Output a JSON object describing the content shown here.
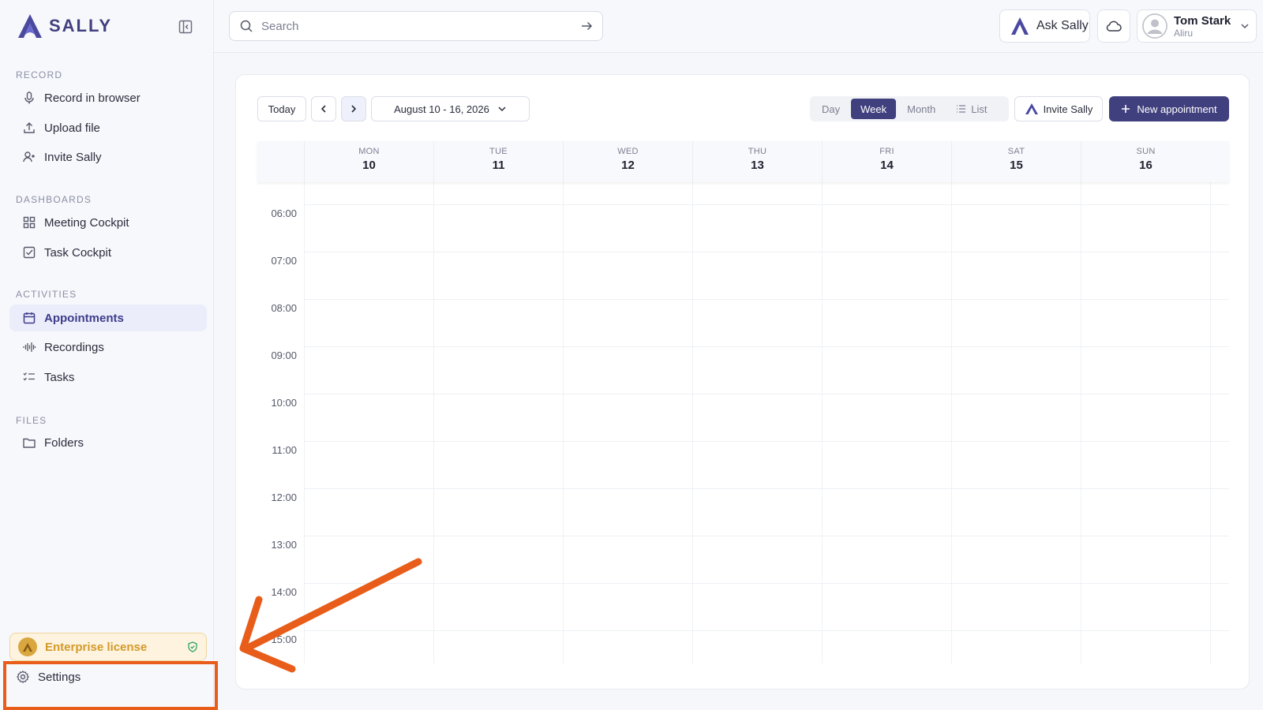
{
  "app": {
    "logo_text": "SALLY"
  },
  "sidebar": {
    "sections": {
      "record": "RECORD",
      "dashboards": "DASHBOARDS",
      "activities": "ACTIVITIES",
      "files": "FILES"
    },
    "items": {
      "record_in_browser": "Record in browser",
      "upload_file": "Upload file",
      "invite_sally": "Invite Sally",
      "meeting_cockpit": "Meeting Cockpit",
      "task_cockpit": "Task Cockpit",
      "appointments": "Appointments",
      "recordings": "Recordings",
      "tasks": "Tasks",
      "folders": "Folders"
    },
    "active_item": "appointments",
    "license": "Enterprise license",
    "settings": "Settings"
  },
  "topbar": {
    "search_placeholder": "Search",
    "ask_label": "Ask Sally",
    "user_name": "Tom Stark",
    "user_org": "Aliru"
  },
  "calendar": {
    "today_label": "Today",
    "date_range": "August 10 - 16, 2026",
    "views": [
      "Day",
      "Week",
      "Month",
      "List"
    ],
    "active_view": "Week",
    "invite_label": "Invite Sally",
    "new_label": "New appointment",
    "days": [
      {
        "name": "MON",
        "num": "10"
      },
      {
        "name": "TUE",
        "num": "11"
      },
      {
        "name": "WED",
        "num": "12"
      },
      {
        "name": "THU",
        "num": "13"
      },
      {
        "name": "FRI",
        "num": "14"
      },
      {
        "name": "SAT",
        "num": "15"
      },
      {
        "name": "SUN",
        "num": "16"
      }
    ],
    "hours": [
      "06:00",
      "07:00",
      "08:00",
      "09:00",
      "10:00",
      "11:00",
      "12:00",
      "13:00",
      "14:00",
      "15:00"
    ]
  },
  "colors": {
    "accent": "#41407f",
    "annotation": "#e85d1a",
    "license": "#d39a2a"
  }
}
